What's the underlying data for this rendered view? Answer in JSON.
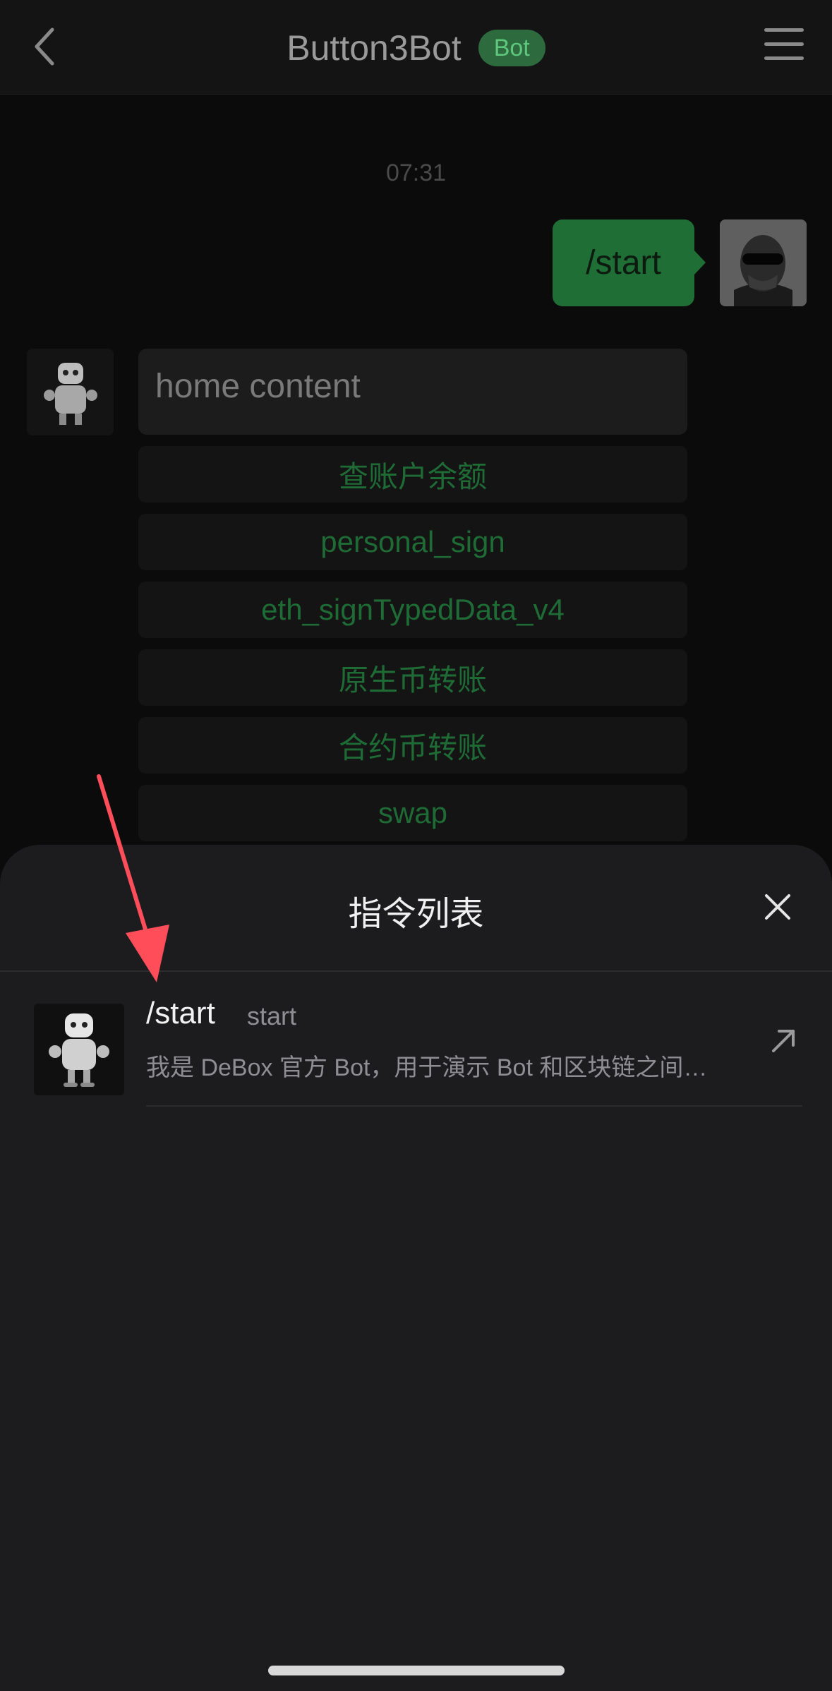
{
  "header": {
    "title": "Button3Bot",
    "badge": "Bot"
  },
  "chat": {
    "timestamp": "07:31",
    "user_message": "/start",
    "bot_message": "home content",
    "buttons": [
      "查账户余额",
      "personal_sign",
      "eth_signTypedData_v4",
      "原生币转账",
      "合约币转账",
      "swap"
    ]
  },
  "command_sheet": {
    "title": "指令列表",
    "commands": [
      {
        "name": "/start",
        "label": "start",
        "description": "我是 DeBox 官方 Bot，用于演示 Bot 和区块链之间…"
      }
    ]
  },
  "colors": {
    "accent_green": "#1f6e36",
    "button_text": "#1f6b36",
    "annotation_arrow": "#ff4d5a"
  },
  "icons": [
    "back-icon",
    "menu-icon",
    "close-icon",
    "external-arrow-icon"
  ]
}
